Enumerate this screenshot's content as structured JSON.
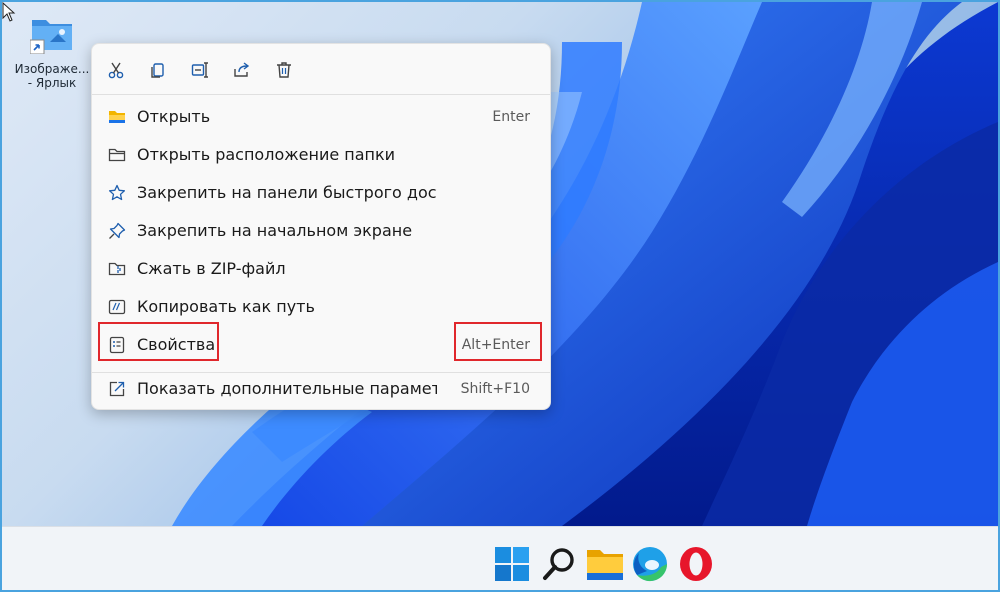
{
  "desktop": {
    "icon": {
      "label_line1": "Изображе...",
      "label_line2": "- Ярлык",
      "icon": "folder-shortcut-icon"
    }
  },
  "context_menu": {
    "toolbar": [
      {
        "icon": "cut-icon",
        "name": "cut"
      },
      {
        "icon": "copy-icon",
        "name": "copy"
      },
      {
        "icon": "rename-icon",
        "name": "rename"
      },
      {
        "icon": "share-icon",
        "name": "share"
      },
      {
        "icon": "delete-icon",
        "name": "delete"
      }
    ],
    "items": [
      {
        "label": "Открыть",
        "shortcut": "Enter",
        "icon": "folder-open-icon"
      },
      {
        "label": "Открыть расположение папки",
        "shortcut": "",
        "icon": "folder-icon"
      },
      {
        "label": "Закрепить на панели быстрого доступа",
        "shortcut": "",
        "icon": "star-icon"
      },
      {
        "label": "Закрепить на начальном экране",
        "shortcut": "",
        "icon": "pin-icon"
      },
      {
        "label": "Сжать в ZIP-файл",
        "shortcut": "",
        "icon": "zip-icon"
      },
      {
        "label": "Копировать как путь",
        "shortcut": "",
        "icon": "copy-path-icon"
      },
      {
        "label": "Свойства",
        "shortcut": "Alt+Enter",
        "icon": "properties-icon",
        "highlighted": true
      },
      {
        "label": "Показать дополнительные параметры",
        "shortcut": "Shift+F10",
        "icon": "more-options-icon"
      }
    ]
  },
  "taskbar": {
    "apps": [
      {
        "icon": "windows-start-icon"
      },
      {
        "icon": "search-icon"
      },
      {
        "icon": "file-explorer-icon"
      },
      {
        "icon": "edge-icon"
      },
      {
        "icon": "opera-icon"
      }
    ]
  },
  "colors": {
    "highlight": "#e0272c",
    "accent": "#0067c0",
    "wallpaper_blue": "#1450e6"
  }
}
